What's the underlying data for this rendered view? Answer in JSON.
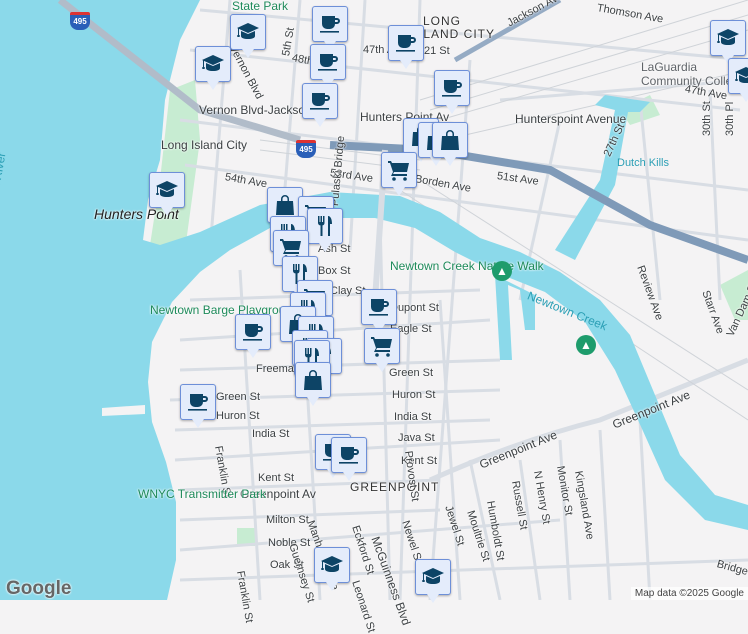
{
  "map": {
    "neighborhoods": {
      "lic": "LONG ISLAND CITY",
      "lic1": "LONG",
      "lic2": "ISLAND CITY",
      "greenpoint": "GREENPOINT",
      "hunters_point": "Hunters Point"
    },
    "water": {
      "east_river": "East River",
      "newtown_creek": "Newtown Creek",
      "dutch_kills": "Dutch Kills"
    },
    "parks": {
      "state_park": "State Park",
      "nature_walk": "Newtown Creek Nature Walk",
      "barge_playground": "Newtown Barge Playground",
      "wnyc": "WNYC Transmitter Park",
      "laguardia": "LaGuardia Community College"
    },
    "transit": {
      "vernon": "Vernon Blvd-Jackson Av",
      "hunters_point_av": "Hunters Point Av",
      "lic_station": "Long Island City",
      "hunterspoint_avenue": "Hunterspoint Avenue",
      "st21": "21 St",
      "greenpoint_av": "Greenpoint Av"
    },
    "highways": {
      "i495": "495"
    },
    "streets": [
      "5th St",
      "48th Ave",
      "47th Ave",
      "54th Ave",
      "53rd Ave",
      "Borden Ave",
      "51st Ave",
      "Jackson Ave",
      "Thomson Ave",
      "27th St",
      "30th St",
      "30th Pl",
      "Review Ave",
      "Starr Ave",
      "Van Dam St",
      "Pulaski Bridge",
      "Ash St",
      "Box St",
      "Clay St",
      "Dupont St",
      "Eagle St",
      "Freeman St",
      "Green St",
      "Huron St",
      "India St",
      "Java St",
      "Kent St",
      "Milton St",
      "Noble St",
      "Oak St",
      "Franklin St",
      "Manhattan Ave",
      "McGuinness Blvd",
      "Eckford St",
      "Leonard St",
      "Newel St",
      "Jewel St",
      "Moultrie St",
      "Humboldt St",
      "Russell St",
      "N Henry St",
      "Monitor St",
      "Kingsland Ave",
      "Provost St",
      "Greenpoint Ave",
      "Bridgewater St",
      "Guernsey St",
      "Vernon Blvd"
    ],
    "attribution": "Map data ©2025 Google",
    "logo": "Google"
  },
  "markers": [
    {
      "type": "school",
      "icon": "graduation-cap-icon"
    },
    {
      "type": "cafe",
      "icon": "coffee-cup-icon"
    },
    {
      "type": "shopping",
      "icon": "shopping-bag-icon"
    },
    {
      "type": "grocery",
      "icon": "shopping-cart-icon"
    },
    {
      "type": "restaurant",
      "icon": "fork-knife-icon"
    }
  ],
  "colors": {
    "water": "#8bd9ea",
    "land": "#f4f3f4",
    "park": "#c7ecd2",
    "road": "#d8dde4",
    "highway": "#7f9ab8",
    "marker_fill": "#e4ecfb",
    "marker_border": "#6d8fd8",
    "icon": "#0d4466"
  }
}
